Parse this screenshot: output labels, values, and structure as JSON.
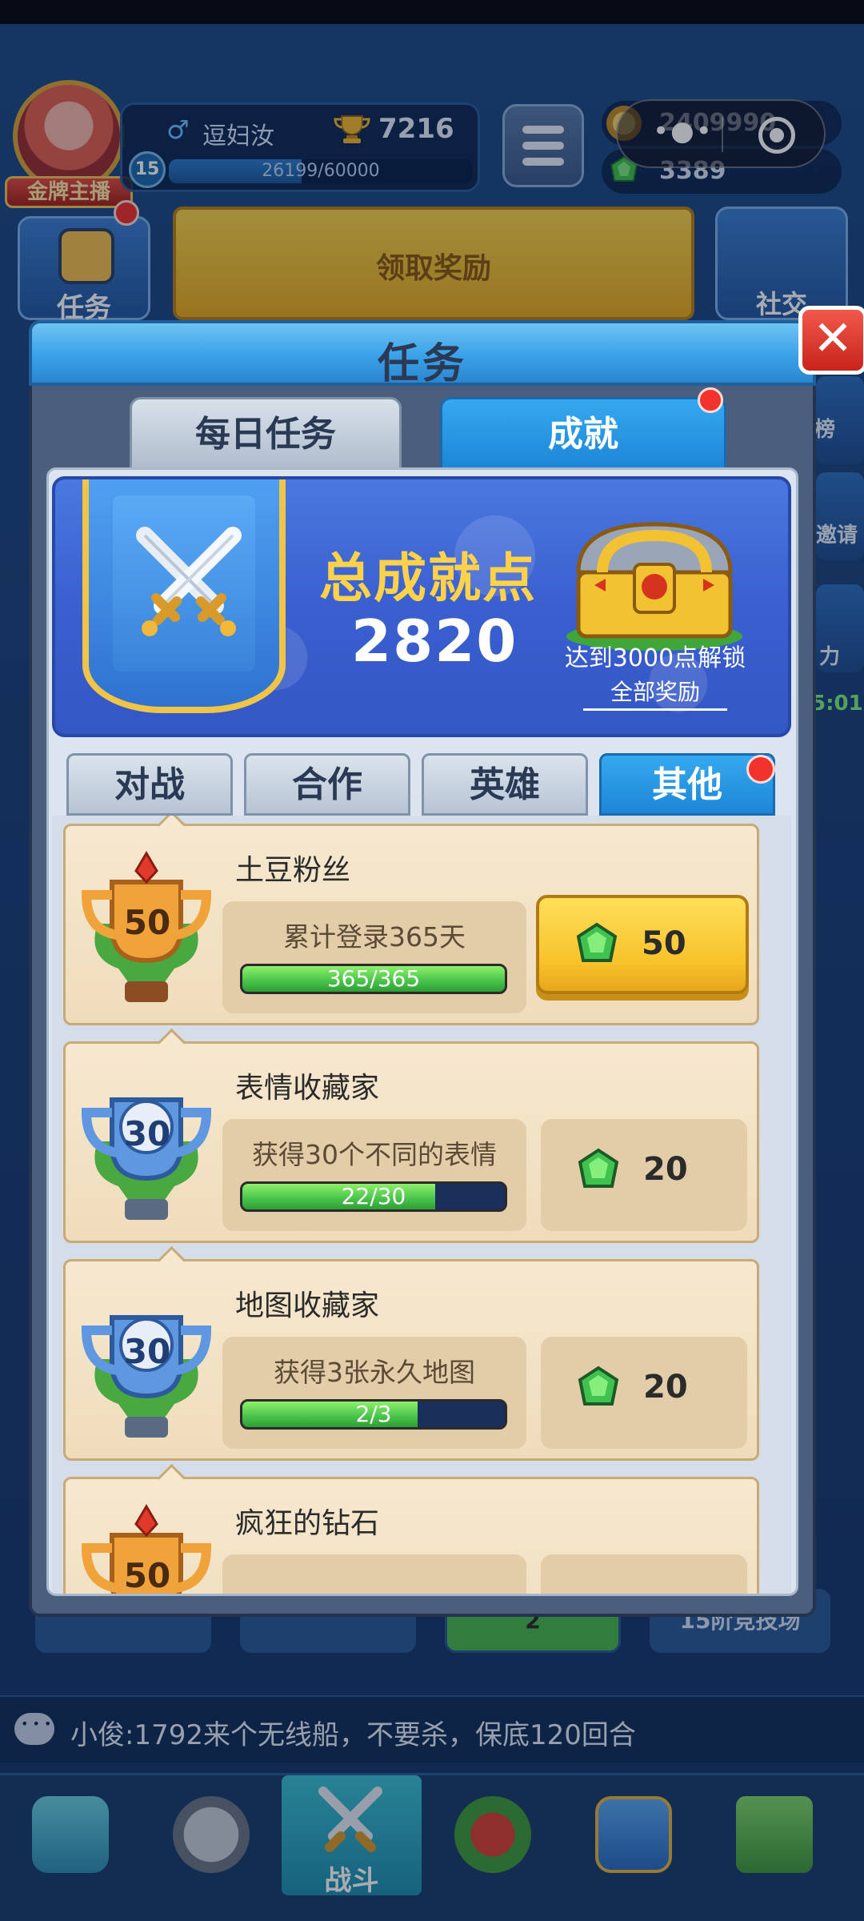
{
  "player": {
    "name": "逗妇汝",
    "trophies": "7216",
    "level": "15",
    "xp": "26199/60000",
    "xp_fraction": 0.4367,
    "badge": "金牌主播"
  },
  "currency": {
    "coins": "2409990",
    "gems": "3389"
  },
  "background": {
    "task_button_label": "任务",
    "claim_reward_label": "领取奖励",
    "community_label": "社交",
    "side_labels": [
      "榜",
      "邀请",
      "力"
    ],
    "timer": "5:01",
    "bottom_left_value": "2",
    "bottom_right_label": "15阶竞技场"
  },
  "ticker": {
    "message": "小俊:1792来个无线船，不要杀，保底120回合"
  },
  "nav": {
    "battle_label": "战斗"
  },
  "modal": {
    "title": "任务",
    "close_label": "✕",
    "tabs": [
      {
        "label": "每日任务",
        "active": false
      },
      {
        "label": "成就",
        "active": true
      }
    ],
    "summary": {
      "title": "总成就点",
      "points": "2820",
      "unlock_text": "达到3000点解锁",
      "link_label": "全部奖励"
    },
    "sub_tabs": [
      {
        "label": "对战"
      },
      {
        "label": "合作"
      },
      {
        "label": "英雄"
      },
      {
        "label": "其他",
        "active": true
      }
    ],
    "achievements": [
      {
        "title": "土豆粉丝",
        "tier": "50",
        "tier_color": "gold",
        "description": "累计登录365天",
        "progress": "365/365",
        "progress_fraction": 1.0,
        "reward": "50",
        "claimable": true
      },
      {
        "title": "表情收藏家",
        "tier": "30",
        "tier_color": "silver",
        "description": "获得30个不同的表情",
        "progress": "22/30",
        "progress_fraction": 0.7333,
        "reward": "20",
        "claimable": false
      },
      {
        "title": "地图收藏家",
        "tier": "30",
        "tier_color": "silver",
        "description": "获得3张永久地图",
        "progress": "2/3",
        "progress_fraction": 0.6667,
        "reward": "20",
        "claimable": false
      },
      {
        "title": "疯狂的钻石",
        "tier": "50",
        "tier_color": "gold"
      }
    ]
  },
  "colors": {
    "accent_blue": "#1d86d6",
    "gold": "#f7c22b",
    "progress_green": "#47c24a",
    "alert_red": "#f2322c"
  }
}
